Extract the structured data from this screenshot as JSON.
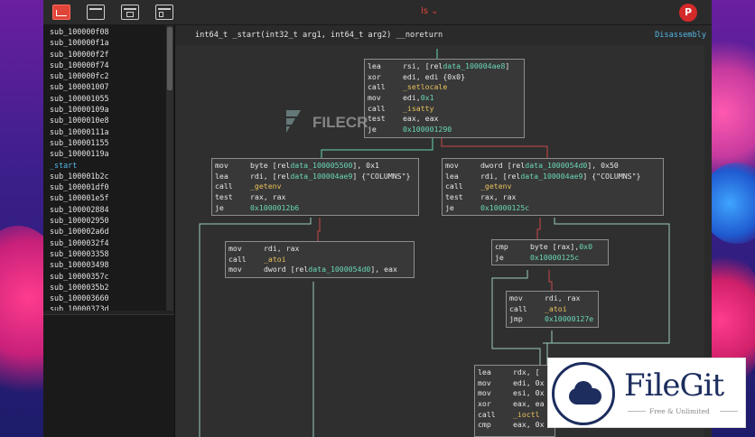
{
  "app": {
    "title_menu": "ls",
    "avatar_letter": "P",
    "toolbar": [
      {
        "name": "graph-view-icon",
        "active": true
      },
      {
        "name": "window-icon",
        "active": false
      },
      {
        "name": "split-view-icon",
        "active": false
      },
      {
        "name": "panel-view-icon",
        "active": false
      }
    ]
  },
  "sidebar": {
    "functions": [
      "sub_100000f08",
      "sub_100000f1a",
      "sub_100000f2f",
      "sub_100000f74",
      "sub_100000fc2",
      "sub_100001007",
      "sub_100001055",
      "sub_10000109a",
      "sub_1000010e8",
      "sub_10000111a",
      "sub_100001155",
      "sub_10000119a",
      "_start",
      "sub_100001b2c",
      "sub_100001df0",
      "sub_100001e5f",
      "sub_100002884",
      "sub_100002950",
      "sub_100002a6d",
      "sub_1000032f4",
      "sub_100003358",
      "sub_100003498",
      "sub_10000357c",
      "sub_1000035b2",
      "sub_100003660",
      "sub_10000373d"
    ],
    "selected_index": 12
  },
  "main": {
    "signature": "int64_t _start(int32_t arg1, int64_t arg2) __noreturn",
    "view_button": "Disassembly"
  },
  "blocks": [
    {
      "id": "b0",
      "lines": [
        {
          "m": "lea",
          "parts": [
            {
              "t": "rsi, [rel ",
              "c": "op"
            },
            {
              "t": "data_100004ae8",
              "c": "addr"
            },
            {
              "t": "]",
              "c": "op"
            }
          ]
        },
        {
          "m": "xor",
          "parts": [
            {
              "t": "edi, edi  {0x0}",
              "c": "op"
            }
          ]
        },
        {
          "m": "call",
          "parts": [
            {
              "t": "_setlocale",
              "c": "fn"
            }
          ]
        },
        {
          "m": "mov",
          "parts": [
            {
              "t": "edi, ",
              "c": "op"
            },
            {
              "t": "0x1",
              "c": "addr"
            }
          ]
        },
        {
          "m": "call",
          "parts": [
            {
              "t": "_isatty",
              "c": "fn"
            }
          ]
        },
        {
          "m": "test",
          "parts": [
            {
              "t": "eax, eax",
              "c": "op"
            }
          ]
        },
        {
          "m": "je",
          "parts": [
            {
              "t": "0x100001290",
              "c": "addr"
            }
          ]
        }
      ]
    },
    {
      "id": "b1",
      "lines": [
        {
          "m": "mov",
          "parts": [
            {
              "t": "byte [rel ",
              "c": "op"
            },
            {
              "t": "data_100005500",
              "c": "addr"
            },
            {
              "t": "], 0x1",
              "c": "op"
            }
          ]
        },
        {
          "m": "lea",
          "parts": [
            {
              "t": "rdi, [rel ",
              "c": "op"
            },
            {
              "t": "data_100004ae9",
              "c": "addr"
            },
            {
              "t": "]  {\"COLUMNS\"}",
              "c": "str"
            }
          ]
        },
        {
          "m": "call",
          "parts": [
            {
              "t": "_getenv",
              "c": "fn"
            }
          ]
        },
        {
          "m": "test",
          "parts": [
            {
              "t": "rax, rax",
              "c": "op"
            }
          ]
        },
        {
          "m": "je",
          "parts": [
            {
              "t": "0x1000012b6",
              "c": "addr"
            }
          ]
        }
      ]
    },
    {
      "id": "b2",
      "lines": [
        {
          "m": "mov",
          "parts": [
            {
              "t": "dword [rel ",
              "c": "op"
            },
            {
              "t": "data_1000054d0",
              "c": "addr"
            },
            {
              "t": "], 0x50",
              "c": "op"
            }
          ]
        },
        {
          "m": "lea",
          "parts": [
            {
              "t": "rdi, [rel ",
              "c": "op"
            },
            {
              "t": "data_100004ae9",
              "c": "addr"
            },
            {
              "t": "]  {\"COLUMNS\"}",
              "c": "str"
            }
          ]
        },
        {
          "m": "call",
          "parts": [
            {
              "t": "_getenv",
              "c": "fn"
            }
          ]
        },
        {
          "m": "test",
          "parts": [
            {
              "t": "rax, rax",
              "c": "op"
            }
          ]
        },
        {
          "m": "je",
          "parts": [
            {
              "t": "0x10000125c",
              "c": "addr"
            }
          ]
        }
      ]
    },
    {
      "id": "b3",
      "lines": [
        {
          "m": "mov",
          "parts": [
            {
              "t": "rdi, rax",
              "c": "op"
            }
          ]
        },
        {
          "m": "call",
          "parts": [
            {
              "t": "_atoi",
              "c": "fn"
            }
          ]
        },
        {
          "m": "mov",
          "parts": [
            {
              "t": "dword [rel ",
              "c": "op"
            },
            {
              "t": "data_1000054d0",
              "c": "addr"
            },
            {
              "t": "], eax",
              "c": "op"
            }
          ]
        }
      ]
    },
    {
      "id": "b4",
      "lines": [
        {
          "m": "cmp",
          "parts": [
            {
              "t": "byte [rax], ",
              "c": "op"
            },
            {
              "t": "0x0",
              "c": "addr"
            }
          ]
        },
        {
          "m": "je",
          "parts": [
            {
              "t": "0x10000125c",
              "c": "addr"
            }
          ]
        }
      ]
    },
    {
      "id": "b5",
      "lines": [
        {
          "m": "mov",
          "parts": [
            {
              "t": "rdi, rax",
              "c": "op"
            }
          ]
        },
        {
          "m": "call",
          "parts": [
            {
              "t": "_atoi",
              "c": "fn"
            }
          ]
        },
        {
          "m": "jmp",
          "parts": [
            {
              "t": "0x10000127e",
              "c": "addr"
            }
          ]
        }
      ]
    },
    {
      "id": "b6",
      "lines": [
        {
          "m": "lea",
          "parts": [
            {
              "t": "rdx, [",
              "c": "op"
            }
          ]
        },
        {
          "m": "mov",
          "parts": [
            {
              "t": "edi, 0x",
              "c": "op"
            }
          ]
        },
        {
          "m": "mov",
          "parts": [
            {
              "t": "esi, 0x",
              "c": "op"
            }
          ]
        },
        {
          "m": "xor",
          "parts": [
            {
              "t": "eax, ea",
              "c": "op"
            }
          ]
        },
        {
          "m": "call",
          "parts": [
            {
              "t": "_ioctl",
              "c": "fn"
            }
          ]
        },
        {
          "m": "cmp",
          "parts": [
            {
              "t": "eax, 0x",
              "c": "op"
            }
          ]
        }
      ]
    }
  ],
  "watermarks": {
    "filecr": "FILECR",
    "filegit_name": "FileGit",
    "filegit_tagline": "Free & Unlimited"
  }
}
